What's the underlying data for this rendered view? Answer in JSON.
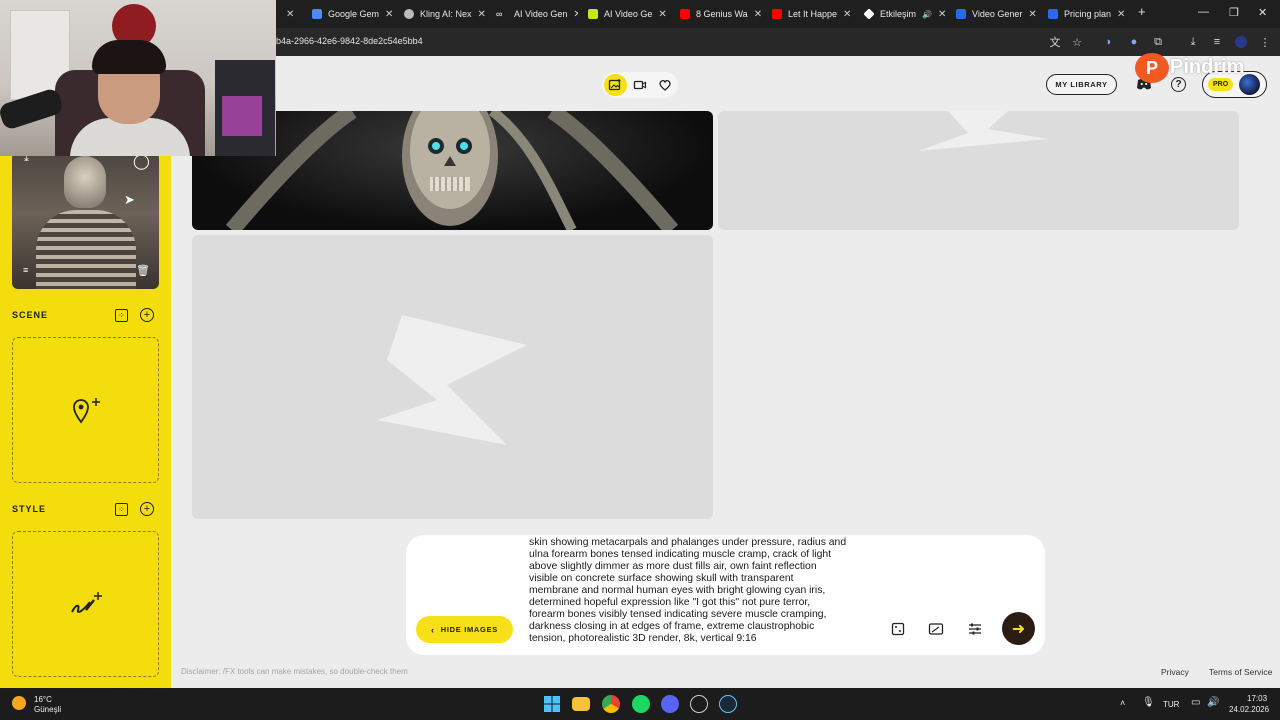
{
  "browser": {
    "tabs": [
      {
        "label": "Google Gem",
        "color": "#4c8bf5"
      },
      {
        "label": "Kling AI: Nex",
        "color": "#bbbbbb"
      },
      {
        "label": "AI Video Gen",
        "color": "#ffffff"
      },
      {
        "label": "AI Video Ge",
        "color": "#c6e61e"
      },
      {
        "label": "8 Genius Wa",
        "color": "#ff0000"
      },
      {
        "label": "Let It Happe",
        "color": "#ff0000"
      },
      {
        "label": "Etkileşim",
        "color": "#ffffff"
      },
      {
        "label": "Video Gener",
        "color": "#2b6ae6"
      },
      {
        "label": "Pricing plan",
        "color": "#2b6ae6"
      }
    ],
    "url": "b4a-2966-42e6-9842-8de2c54e5bb4"
  },
  "header": {
    "library_label": "MY LIBRARY",
    "pro_label": "PRO",
    "brand_logo": "P",
    "brand_text": "Pindrim"
  },
  "sidebar": {
    "scene_title": "SCENE",
    "style_title": "STYLE"
  },
  "prompt": {
    "text": "skin showing metacarpals and phalanges under pressure, radius and\nulna forearm bones tensed indicating muscle cramp, crack of light\nabove slightly dimmer as more dust fills air, own faint reflection\nvisible on concrete surface showing skull with transparent\nmembrane and normal human eyes with bright glowing cyan iris,\ndetermined hopeful expression like \"I got this\" not pure terror,\nforearm bones visibly tensed indicating severe muscle cramping,\ndarkness closing in at edges of frame, extreme claustrophobic\ntension, photorealistic 3D render, 8k, vertical 9:16",
    "hide_images_label": "HIDE IMAGES"
  },
  "footer": {
    "disclaimer": "Disclaimer: /FX tools can make mistakes, so double-check them",
    "privacy": "Privacy",
    "terms": "Terms of Service"
  },
  "taskbar": {
    "temperature": "16°C",
    "weather": "Güneşli",
    "language": "TUR",
    "time": "17:03",
    "date": "24.02.2026"
  },
  "icons": {
    "accent_yellow": "#f7e017",
    "sidebar_yellow": "#f4dd0d"
  }
}
